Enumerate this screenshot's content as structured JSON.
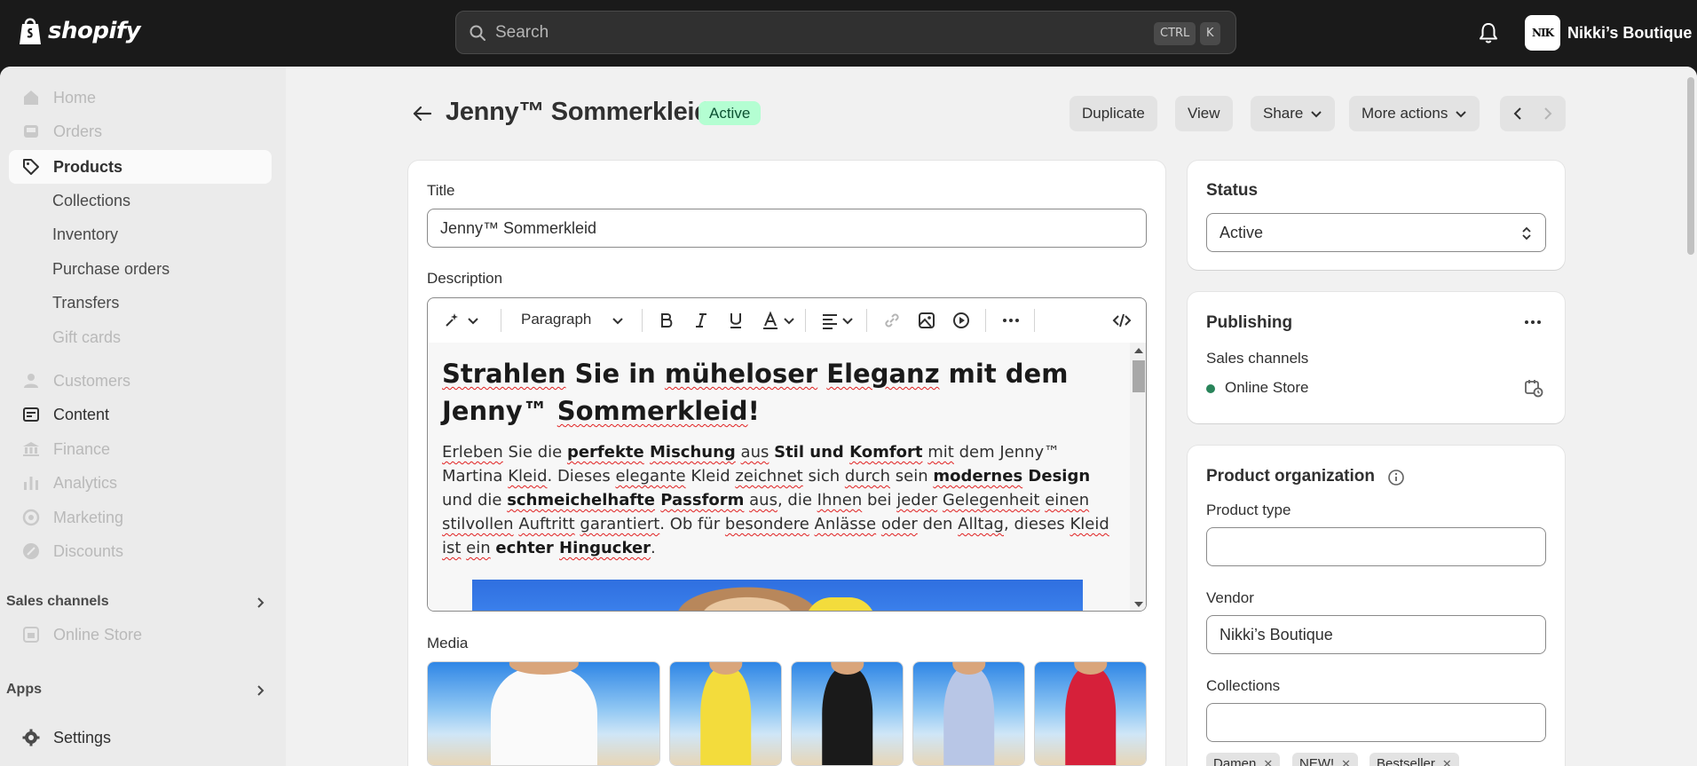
{
  "topbar": {
    "brand": "shopify",
    "search_placeholder": "Search",
    "kbd_ctrl": "CTRL",
    "kbd_k": "K",
    "store_name": "Nikki’s Boutique",
    "avatar_text": "NIK"
  },
  "sidebar": {
    "home": "Home",
    "orders": "Orders",
    "products": "Products",
    "collections": "Collections",
    "inventory": "Inventory",
    "purchase_orders": "Purchase orders",
    "transfers": "Transfers",
    "gift_cards": "Gift cards",
    "customers": "Customers",
    "content": "Content",
    "finance": "Finance",
    "analytics": "Analytics",
    "marketing": "Marketing",
    "discounts": "Discounts",
    "sales_channels": "Sales channels",
    "online_store": "Online Store",
    "apps": "Apps",
    "settings": "Settings"
  },
  "header": {
    "title": "Jenny™ Sommerkleid",
    "status_badge": "Active",
    "duplicate": "Duplicate",
    "view": "View",
    "share": "Share",
    "more_actions": "More actions"
  },
  "product": {
    "title_label": "Title",
    "title_value": "Jenny™ Sommerkleid",
    "description_label": "Description",
    "format_select": "Paragraph",
    "heading": "Strahlen Sie in müheloser Eleganz mit dem Jenny™ Sommerkleid!",
    "media_label": "Media"
  },
  "status_card": {
    "label": "Status",
    "value": "Active"
  },
  "publishing": {
    "label": "Publishing",
    "sales_channels": "Sales channels",
    "channel": "Online Store"
  },
  "organization": {
    "label": "Product organization",
    "product_type_label": "Product type",
    "product_type_value": "",
    "vendor_label": "Vendor",
    "vendor_value": "Nikki’s Boutique",
    "collections_label": "Collections",
    "collections_value": "",
    "tags": [
      "Damen",
      "NEW!",
      "Bestseller"
    ]
  },
  "media_colors": [
    "#ffffff",
    "#f3dc3c",
    "#1a1a1a",
    "#b8c6e6",
    "#d6203a"
  ]
}
